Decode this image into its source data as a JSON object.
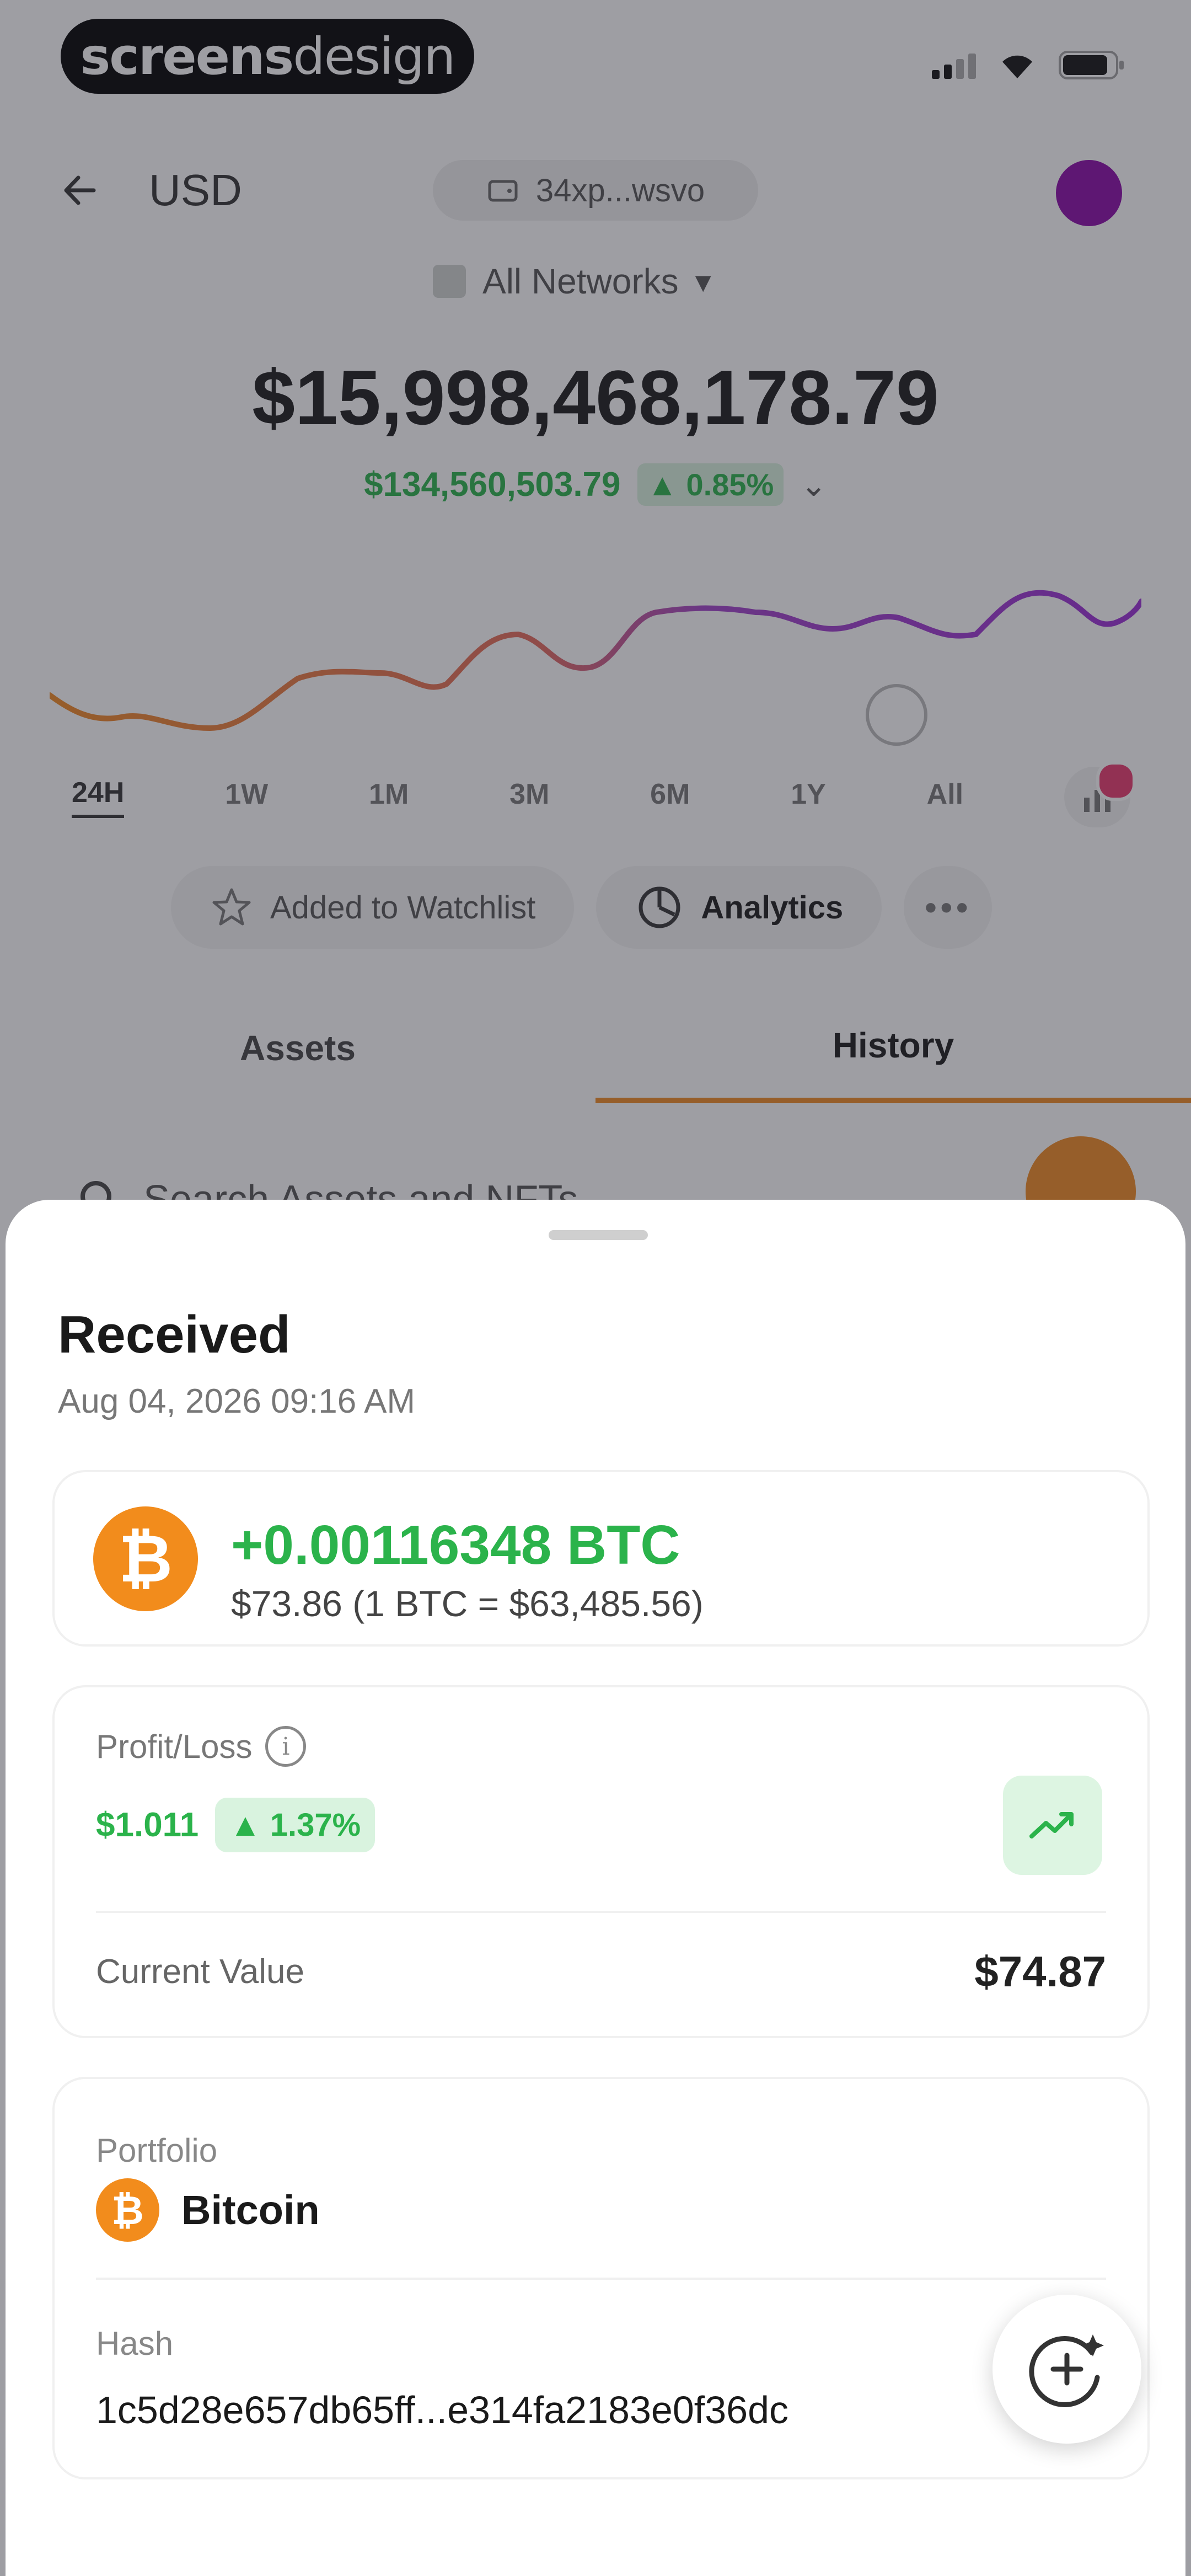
{
  "status_bar": {
    "brand_bold": "screens",
    "brand_light": "design"
  },
  "header": {
    "currency": "USD",
    "address": "34xp...wsvo",
    "network": "All Networks"
  },
  "portfolio": {
    "balance": "$15,998,468,178.79",
    "change_value": "$134,560,503.79",
    "change_percent": "▲ 0.85%"
  },
  "chart_tooltip": "",
  "ranges": [
    "24H",
    "1W",
    "1M",
    "3M",
    "6M",
    "1Y",
    "All"
  ],
  "actions": {
    "watchlist": "Added to Watchlist",
    "analytics": "Analytics"
  },
  "tabs": {
    "assets": "Assets",
    "history": "History"
  },
  "search": {
    "placeholder": "Search Assets and NFTs"
  },
  "sheet": {
    "title": "Received",
    "date": "Aug 04, 2026 09:16 AM",
    "amount": "+0.00116348 BTC",
    "fiat": "$73.86 (1 BTC = $63,485.56)",
    "profit_loss_label": "Profit/Loss",
    "profit_loss_value": "$1.011",
    "profit_loss_percent": "▲ 1.37%",
    "current_value_label": "Current Value",
    "current_value": "$74.87",
    "portfolio_label": "Portfolio",
    "portfolio_name": "Bitcoin",
    "hash_label": "Hash",
    "hash_value": "1c5d28e657db65ff...e314fa2183e0f36dc"
  },
  "colors": {
    "accent": "#f08a24",
    "positive": "#2bb34b",
    "bitcoin": "#f28c1c",
    "avatar": "#8a0aa8"
  },
  "icons": [
    "back-arrow-icon",
    "wallet-icon",
    "network-icon",
    "chevron-down-icon",
    "star-icon",
    "analytics-icon",
    "more-icon",
    "search-icon",
    "bitcoin-icon",
    "info-icon",
    "trend-up-icon",
    "sparkle-add-icon"
  ]
}
